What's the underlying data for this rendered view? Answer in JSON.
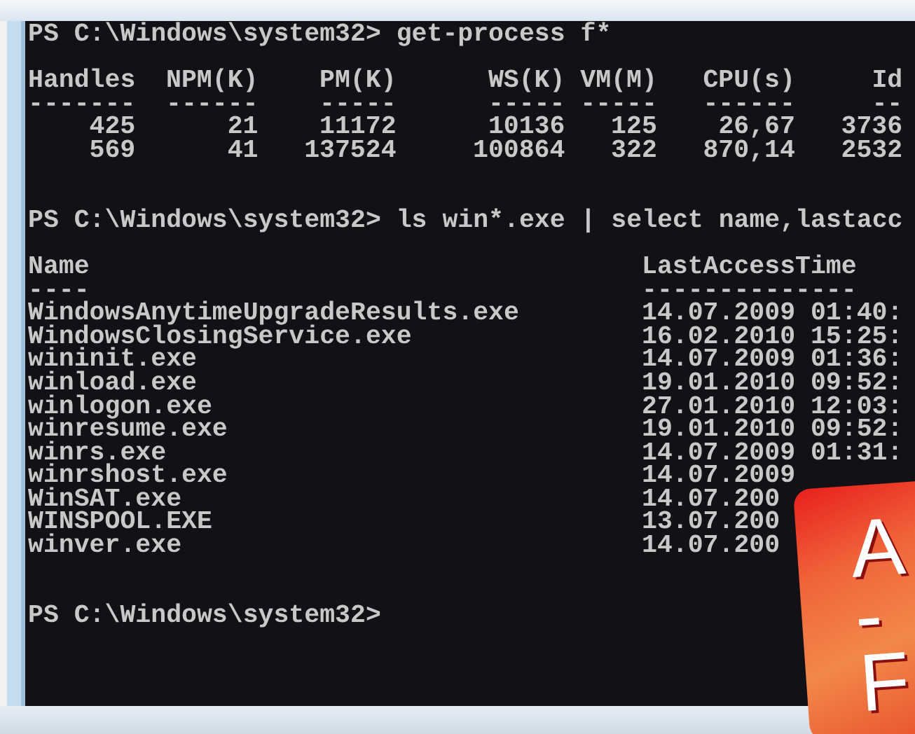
{
  "console": {
    "blocks": [
      {
        "kind": "prompt",
        "text": "PS C:\\Windows\\system32> get-process f*"
      },
      {
        "kind": "blank"
      },
      {
        "kind": "process_table",
        "columns": [
          {
            "label": "Handles",
            "rule": "-------"
          },
          {
            "label": "NPM(K)",
            "rule": "------"
          },
          {
            "label": "PM(K)",
            "rule": "-----"
          },
          {
            "label": "WS(K)",
            "rule": "-----"
          },
          {
            "label": "VM(M)",
            "rule": "-----"
          },
          {
            "label": "CPU(s)",
            "rule": "------"
          },
          {
            "label": "Id",
            "rule": "--"
          }
        ],
        "rows": [
          [
            "425",
            "21",
            "11172",
            "10136",
            "125",
            "26,67",
            "3736"
          ],
          [
            "569",
            "41",
            "137524",
            "100864",
            "322",
            "870,14",
            "2532"
          ]
        ]
      },
      {
        "kind": "blank"
      },
      {
        "kind": "blank"
      },
      {
        "kind": "prompt",
        "text": "PS C:\\Windows\\system32> ls win*.exe | select name,lastacc"
      },
      {
        "kind": "blank"
      },
      {
        "kind": "list_table",
        "columns": [
          {
            "label": "Name",
            "rule": "----"
          },
          {
            "label": "LastAccessTime",
            "rule": "--------------"
          }
        ],
        "rows": [
          [
            "WindowsAnytimeUpgradeResults.exe",
            "14.07.2009 01:40:"
          ],
          [
            "WindowsClosingService.exe",
            "16.02.2010 15:25:"
          ],
          [
            "wininit.exe",
            "14.07.2009 01:36:"
          ],
          [
            "winload.exe",
            "19.01.2010 09:52:"
          ],
          [
            "winlogon.exe",
            "27.01.2010 12:03:"
          ],
          [
            "winresume.exe",
            "19.01.2010 09:52:"
          ],
          [
            "winrs.exe",
            "14.07.2009 01:31:"
          ],
          [
            "winrshost.exe",
            "14.07.2009"
          ],
          [
            "WinSAT.exe",
            "14.07.200"
          ],
          [
            "WINSPOOL.EXE",
            "13.07.200"
          ],
          [
            "winver.exe",
            "14.07.200"
          ]
        ]
      },
      {
        "kind": "blank"
      },
      {
        "kind": "blank"
      },
      {
        "kind": "prompt",
        "text": "PS C:\\Windows\\system32>"
      }
    ]
  },
  "badge": {
    "lines": [
      "A",
      "-",
      "F"
    ]
  }
}
